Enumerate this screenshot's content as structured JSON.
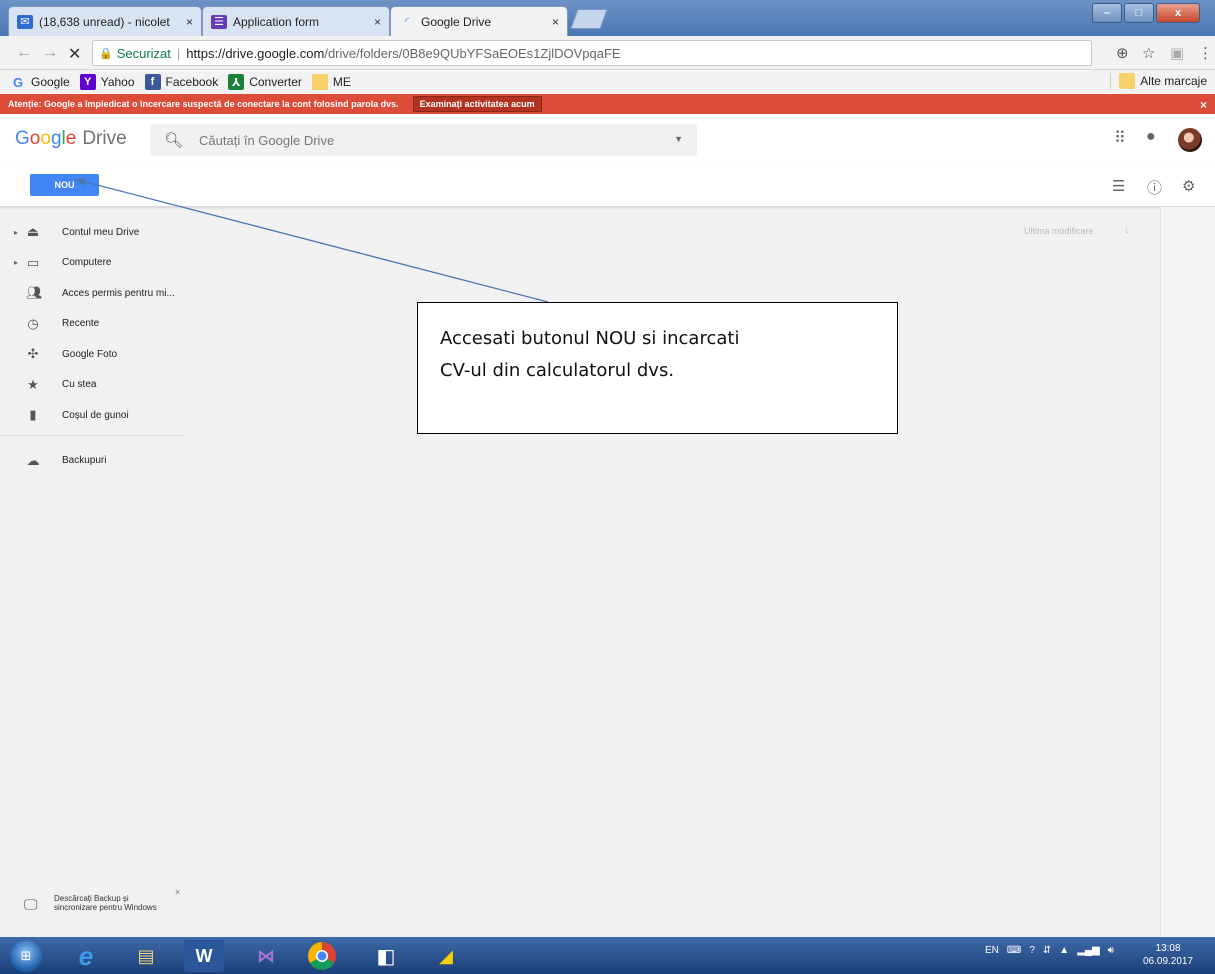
{
  "browser": {
    "tabs": [
      {
        "label": "(18,638 unread) - nicolet",
        "icon": "mail-icon",
        "close": "×"
      },
      {
        "label": "Application form",
        "icon": "forms-icon",
        "close": "×"
      },
      {
        "label": "Google Drive",
        "icon": "loading-icon",
        "close": "×"
      }
    ],
    "window_controls": {
      "minimize": "–",
      "maximize": "□",
      "close": "x"
    },
    "address": {
      "secure_label": "Securizat",
      "url_host": "https://drive.google.com",
      "url_path": "/drive/folders/0B8e9QUbYFSaEOEs1ZjlDOVpqaFE"
    },
    "bookmarks": [
      {
        "label": "Google",
        "icon": "google-icon"
      },
      {
        "label": "Yahoo",
        "icon": "yahoo-icon"
      },
      {
        "label": "Facebook",
        "icon": "facebook-icon"
      },
      {
        "label": "Converter",
        "icon": "converter-icon"
      },
      {
        "label": "ME",
        "icon": "folder-icon"
      }
    ],
    "other_bookmarks": "Alte marcaje"
  },
  "warning": {
    "text": "Atenție: Google a împiedicat o încercare suspectă de conectare la cont folosind parola dvs.",
    "button": "Examinați activitatea acum",
    "close": "×"
  },
  "drive": {
    "logo": {
      "g": "G",
      "o1": "o",
      "o2": "o",
      "g2": "g",
      "l": "l",
      "e": "e",
      "product": "Drive"
    },
    "search_placeholder": "Căutați în Google Drive",
    "new_button": "NOU",
    "sidebar": [
      {
        "label": "Contul meu Drive",
        "icon": "drive-icon",
        "expand": "▸"
      },
      {
        "label": "Computere",
        "icon": "computers-icon",
        "expand": "▸"
      },
      {
        "label": "Acces permis pentru mi...",
        "icon": "shared-icon",
        "expand": ""
      },
      {
        "label": "Recente",
        "icon": "clock-icon",
        "expand": ""
      },
      {
        "label": "Google Foto",
        "icon": "photos-icon",
        "expand": ""
      },
      {
        "label": "Cu stea",
        "icon": "star-icon",
        "expand": ""
      },
      {
        "label": "Coșul de gunoi",
        "icon": "trash-icon",
        "expand": ""
      }
    ],
    "backups": {
      "label": "Backupuri",
      "icon": "cloud-icon"
    },
    "sort": {
      "label": "Ultima modificare",
      "arrow": "↓"
    },
    "toast": {
      "text": "Descărcați Backup și sincronizare pentru Windows",
      "close": "×"
    }
  },
  "callout": {
    "line1": "Accesati butonul NOU si incarcati",
    "line2": "CV-ul din calculatorul dvs."
  },
  "taskbar": {
    "apps": [
      "ie-icon",
      "explorer-icon",
      "word-icon",
      "vs-icon",
      "chrome-icon",
      "outlook-icon",
      "app-icon"
    ],
    "language": "EN",
    "time": "13:08",
    "date": "06.09.2017"
  },
  "colors": {
    "drive_blue": "#4285f4",
    "warning_red": "#dd4b39",
    "secure_green": "#0b8043",
    "taskbar_blue": "#2a5596"
  }
}
